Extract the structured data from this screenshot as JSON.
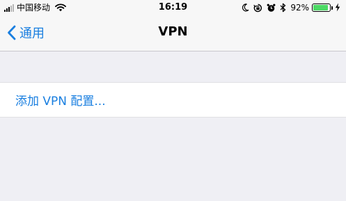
{
  "status_bar": {
    "carrier": "中国移动",
    "time": "16:19",
    "battery_percent": "92%",
    "battery_level": 0.92,
    "icons": [
      "moon-icon",
      "orientation-lock-icon",
      "alarm-icon",
      "bluetooth-icon",
      "charging-icon"
    ]
  },
  "nav": {
    "back_label": "通用",
    "title": "VPN"
  },
  "list": {
    "add_vpn_label": "添加 VPN 配置..."
  },
  "colors": {
    "accent": "#1a7fe0",
    "battery_fill": "#4cd964",
    "background": "#efeff4"
  }
}
